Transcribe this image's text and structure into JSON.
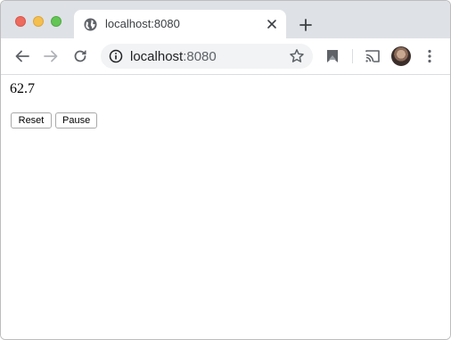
{
  "window": {
    "controls": [
      "close",
      "minimize",
      "zoom"
    ]
  },
  "tab": {
    "title": "localhost:8080",
    "icon": "globe-icon"
  },
  "toolbar": {
    "url_host": "localhost",
    "url_port": ":8080",
    "icons": [
      "back-arrow-icon",
      "forward-arrow-icon",
      "reload-icon",
      "info-icon",
      "star-icon",
      "bookmark-extension-icon",
      "cast-icon",
      "profile-avatar",
      "more-menu-icon"
    ]
  },
  "page": {
    "value": "62.7",
    "buttons": {
      "reset_label": "Reset",
      "pause_label": "Pause"
    }
  },
  "colors": {
    "titlebar": "#dee1e6",
    "close": "#ed6a5e",
    "minimize": "#f5bf4f",
    "zoom": "#62c554",
    "omnibox": "#f1f3f4"
  }
}
